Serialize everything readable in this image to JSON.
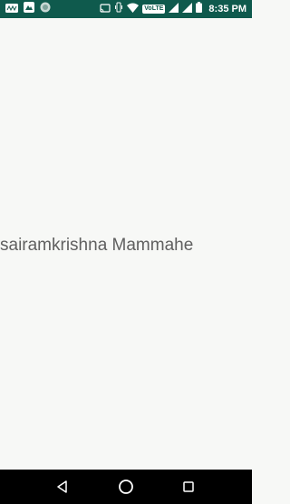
{
  "status_bar": {
    "time": "8:35 PM",
    "left_icons": [
      "carrier-logo-icon",
      "notification-app-icon",
      "circle-app-icon"
    ],
    "right_icons": [
      "cast-icon",
      "vibrate-icon",
      "wifi-icon",
      "volte-icon",
      "signal-icon",
      "signal-icon",
      "battery-icon"
    ],
    "volte_label": "VoLTE",
    "accent_color": "#0f5a4d"
  },
  "main": {
    "text": "sairamkrishna Mammahe"
  },
  "nav_bar": {
    "buttons": [
      "back-icon",
      "home-icon",
      "recents-icon"
    ]
  }
}
